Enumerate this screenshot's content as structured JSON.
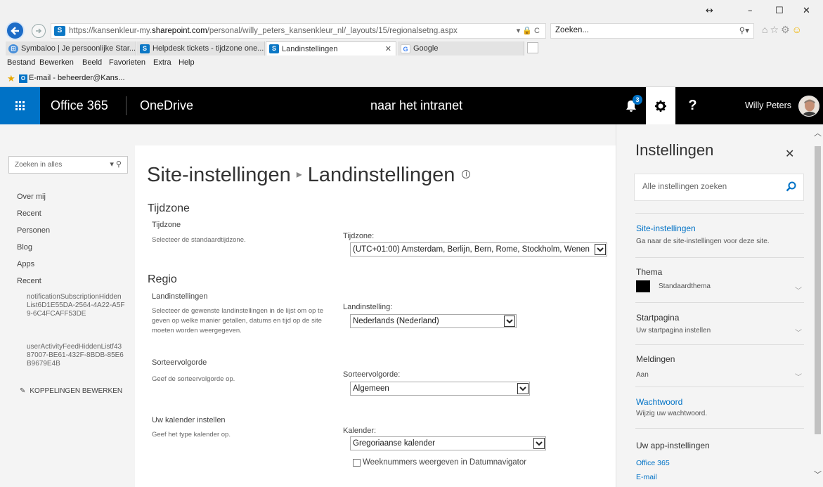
{
  "browser": {
    "url_prefix": "https://kansenkleur-my.",
    "url_domain": "sharepoint.com",
    "url_path": "/personal/willy_peters_kansenkleur_nl/_layouts/15/regionalsetng.aspx",
    "url_tools": "▾ 🔒 C",
    "search_text": "Zoeken...",
    "window_controls": [
      "↔",
      "–",
      "☐",
      "✕"
    ],
    "tabs": [
      {
        "label": "Symbaloo | Je persoonlijke Star...",
        "icon": "symbaloo-icon",
        "color": "#4a90d9"
      },
      {
        "label": "Helpdesk tickets - tijdzone one...",
        "icon": "sharepoint-icon",
        "color": "#0b77c5"
      },
      {
        "label": "Landinstellingen",
        "icon": "sharepoint-icon",
        "color": "#0b77c5"
      },
      {
        "label": "Google",
        "icon": "google-icon",
        "color": "#4285f4"
      }
    ],
    "menu": [
      "Bestand",
      "Bewerken",
      "Beeld",
      "Favorieten",
      "Extra",
      "Help"
    ],
    "favorite": "E-mail - beheerder@Kans..."
  },
  "suitebar": {
    "brand": "Office 365",
    "app": "OneDrive",
    "center_link": "naar het intranet",
    "notification_count": "3",
    "help": "?",
    "user": "Willy Peters"
  },
  "leftnav": {
    "search_placeholder": "Zoeken in alles",
    "items": [
      "Over mij",
      "Recent",
      "Personen",
      "Blog",
      "Apps",
      "Recent"
    ],
    "recent_items": [
      "notificationSubscriptionHiddenList6D1E55DA-2564-4A22-A5F9-6C4FCAFF53DE",
      "userActivityFeedHiddenListf4387007-BE61-432F-8BDB-85E6B9679E4B"
    ],
    "edit_links": "KOPPELINGEN BEWERKEN"
  },
  "main": {
    "breadcrumb_root": "Site-instellingen",
    "breadcrumb_current": "Landinstellingen",
    "sections": {
      "tijdzone": {
        "heading": "Tijdzone",
        "subheading": "Tijdzone",
        "description": "Selecteer de standaardtijdzone.",
        "label": "Tijdzone:",
        "value": "(UTC+01:00) Amsterdam, Berlijn, Bern, Rome, Stockholm, Wenen"
      },
      "regio": {
        "heading": "Regio",
        "landinstellingen_title": "Landinstellingen",
        "landinstellingen_desc": "Selecteer de gewenste landinstellingen in de lijst om op te geven op welke manier getallen, datums en tijd op de site moeten worden weergegeven.",
        "landinstelling_label": "Landinstelling:",
        "landinstelling_value": "Nederlands (Nederland)",
        "sorteer_title": "Sorteervolgorde",
        "sorteer_desc": "Geef de sorteervolgorde op.",
        "sorteer_label": "Sorteervolgorde:",
        "sorteer_value": "Algemeen",
        "kalender_title": "Uw kalender instellen",
        "kalender_desc": "Geef het type kalender op.",
        "kalender_label": "Kalender:",
        "kalender_value": "Gregoriaanse kalender",
        "week_checkbox": "Weeknummers weergeven in Datumnavigator"
      }
    }
  },
  "panel": {
    "title": "Instellingen",
    "search_placeholder": "Alle instellingen zoeken",
    "site_settings_link": "Site-instellingen",
    "site_settings_desc": "Ga naar de site-instellingen voor deze site.",
    "theme_heading": "Thema",
    "theme_value": "Standaardthema",
    "start_heading": "Startpagina",
    "start_value": "Uw startpagina instellen",
    "notif_heading": "Meldingen",
    "notif_value": "Aan",
    "password_link": "Wachtwoord",
    "password_desc": "Wijzig uw wachtwoord.",
    "app_heading": "Uw app-instellingen",
    "app_link_1": "Office 365",
    "app_link_2": "E-mail"
  },
  "colors": {
    "accent": "#0072c6",
    "suitebar": "#000000",
    "panel_bg": "#f4f4f4"
  }
}
